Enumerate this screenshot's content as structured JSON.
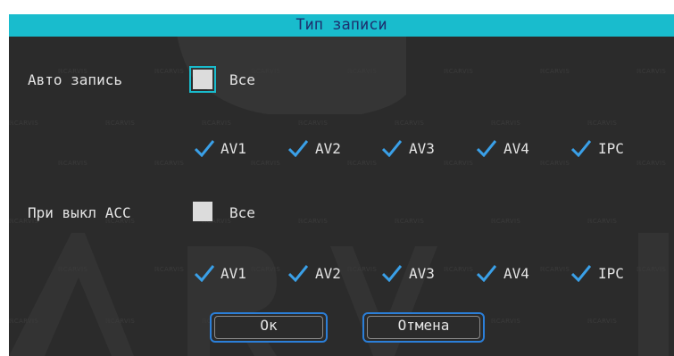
{
  "dialog": {
    "title": "Тип записи"
  },
  "auto_record": {
    "label": "Авто запись",
    "all_label": "Все",
    "all_checked": false,
    "channels": [
      {
        "label": "AV1",
        "checked": true
      },
      {
        "label": "AV2",
        "checked": true
      },
      {
        "label": "AV3",
        "checked": true
      },
      {
        "label": "AV4",
        "checked": true
      },
      {
        "label": "IPC",
        "checked": true
      }
    ]
  },
  "acc_off_record": {
    "label": "При выкл ACC",
    "all_label": "Все",
    "all_checked": false,
    "channels": [
      {
        "label": "AV1",
        "checked": true
      },
      {
        "label": "AV2",
        "checked": true
      },
      {
        "label": "AV3",
        "checked": true
      },
      {
        "label": "AV4",
        "checked": true
      },
      {
        "label": "IPC",
        "checked": true
      }
    ]
  },
  "buttons": {
    "ok": "Ок",
    "cancel": "Отмена"
  },
  "watermark": {
    "text": "CARVIS"
  },
  "colors": {
    "title_bar": "#19bccd",
    "title_text": "#1d2f6e",
    "check": "#3aa0e8",
    "button_border": "#2b7fd9",
    "background": "#2b2b2b"
  }
}
